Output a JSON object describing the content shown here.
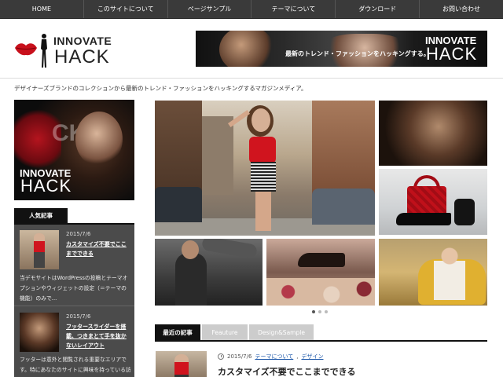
{
  "nav": {
    "items": [
      "HOME",
      "このサイトについて",
      "ページサンプル",
      "テーマについて",
      "ダウンロード",
      "お問い合わせ"
    ]
  },
  "header": {
    "logo": {
      "word1": "INNOVATE",
      "word2": "HACK"
    },
    "banner": {
      "tagline": "最新のトレンド・ファッションをハッキングする。",
      "word1": "INNOVATE",
      "word2": "HACK"
    }
  },
  "site_tagline": "デザイナーズブランドのコレクションから最新のトレンド・ファッションをハッキングするマガジンメディア。",
  "sidebar": {
    "banner": {
      "overlay": "CK",
      "word1": "INNOVATE",
      "word2": "HACK"
    },
    "popular_label": "人気記事",
    "popular": [
      {
        "date": "2015/7/6",
        "title": "カスタマイズ不要でここまでできる",
        "desc": "当デモサイトはWordPressの投稿とテーマオプションやウィジェットの設定（＝テーマの機能）のみで..."
      },
      {
        "date": "2015/7/6",
        "title": "フッタースライダーを搭載、つきまとて手を抜かないレイアウト",
        "desc": "フッターは意外と閲覧される重要なエリアです。特にあなたのサイトに興味を持っている訪問者は"
      }
    ]
  },
  "slider": {
    "dots": 3,
    "active": 0
  },
  "tabs": [
    "最近の記事",
    "Feauture",
    "Design&Sample"
  ],
  "recent_post": {
    "date": "2015/7/6",
    "categories": [
      "テーマについて",
      "デザイン"
    ],
    "separator": ",",
    "title": "カスタマイズ不要でここまでできる"
  }
}
